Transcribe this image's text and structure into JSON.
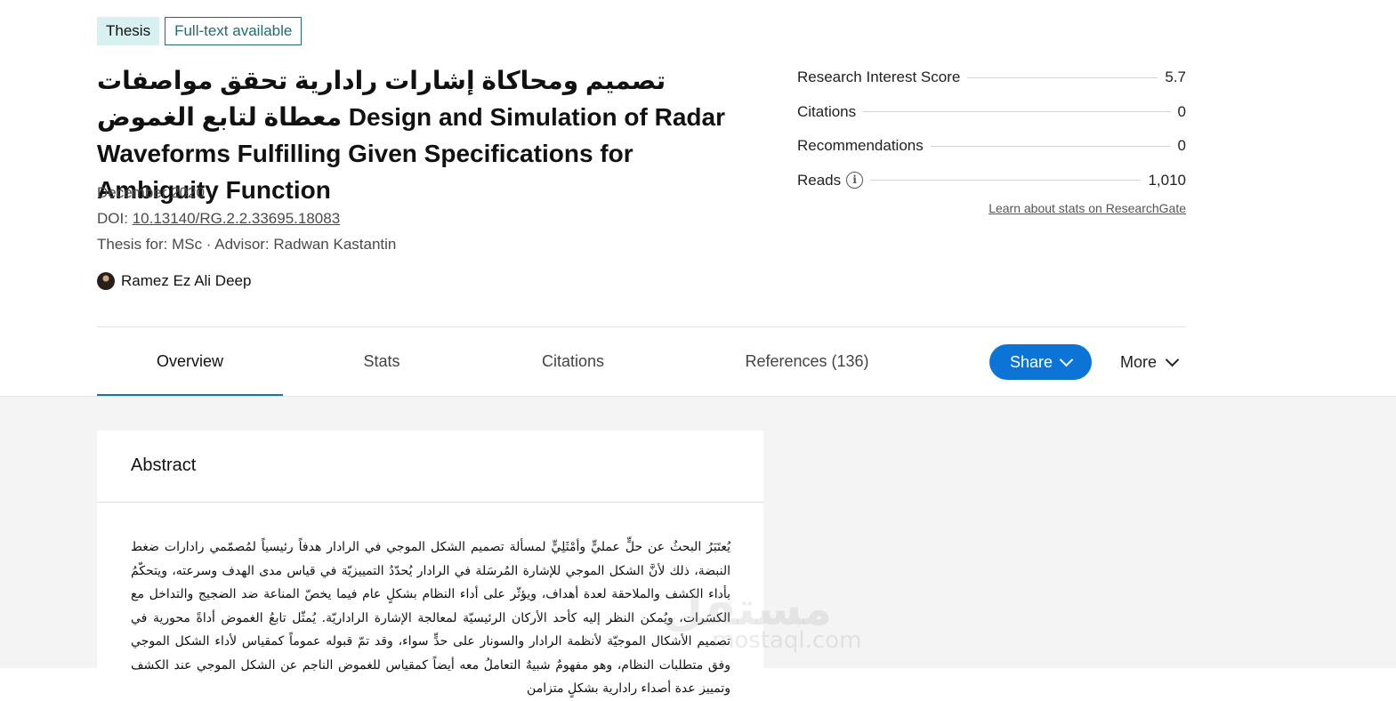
{
  "header": {
    "badges": {
      "type": "Thesis",
      "availability": "Full-text available"
    },
    "title": "تصميم ومحاكاة إشارات رادارية تحقق مواصفات معطاة لتابع الغموض Design and Simulation of Radar Waveforms Fulfilling Given Specifications for Ambiguity Function",
    "date": "December 2020",
    "doi_label": "DOI:",
    "doi": "10.13140/RG.2.2.33695.18083",
    "thesis_info": "Thesis for: MSc · Advisor: Radwan Kastantin",
    "author": "Ramez Ez Ali Deep"
  },
  "stats": {
    "rows": [
      {
        "label": "Research Interest Score",
        "value": "5.7"
      },
      {
        "label": "Citations",
        "value": "0"
      },
      {
        "label": "Recommendations",
        "value": "0"
      },
      {
        "label": "Reads",
        "value": "1,010"
      }
    ],
    "learn_link": "Learn about stats on ResearchGate"
  },
  "tabs": {
    "overview": "Overview",
    "stats": "Stats",
    "citations": "Citations",
    "references": "References (136)",
    "active": "Overview"
  },
  "actions": {
    "share": "Share",
    "more": "More"
  },
  "abstract": {
    "heading": "Abstract",
    "text": "يُعتَبَرُ البحثُ عن حلٍّ عمليٍّ وأمْثَلِيٍّ لمسألة تصميم الشكل الموجي في الرادار هدفاً رئيسياً لمُصمّمي رادارات ضغط النبضة، ذلك لأنَّ الشكل الموجي للإشارة المُرسَلة في الرادار يُحدّدُ التمييزيّة في قياس مدى الهدف وسرعته، ويتحكّمُ بأداء الكشف والملاحقة لعدة أهداف، ويؤثّر على أداء النظام بشكلٍ عام فيما يخصّ المناعة ضد الضجيج والتداخل مع الكسَرات، ويُمكن النظر إليه كأحد الأركان الرئيسيّة لمعالجة الإشارة الراداريّة. يُمثّل تابعُ الغموض أداةً محورية في تصميم الأشكال الموجيّة لأنظمة الرادار والسونار على حدٍّ سواء، وقد تمّ قبوله عموماً كمقياس لأداء الشكل الموجي وفق متطلبات النظام، وهو مفهومٌ شبيهٌ التعاملُ معه أيضاً كمقياس للغموض الناجم عن الشكل الموجي عند الكشف وتمييز عدة أصداء رادارية بشكلٍ متزامن"
  },
  "watermark": {
    "main": "مستقل",
    "sub": "mostaql.com"
  },
  "colors": {
    "accent": "#0b74d6",
    "badge_bg": "#d9f0f1",
    "badge_border": "#1f6d70",
    "page_bg": "#f4f4f4"
  }
}
